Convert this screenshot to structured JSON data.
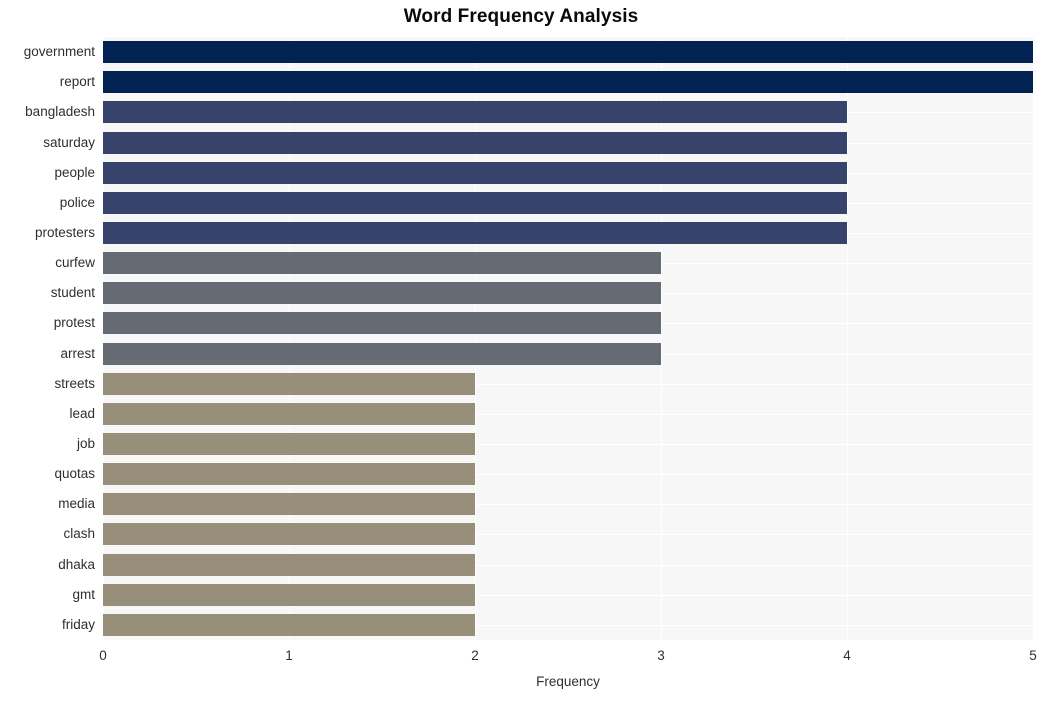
{
  "chart_data": {
    "type": "bar",
    "orientation": "horizontal",
    "title": "Word Frequency Analysis",
    "xlabel": "Frequency",
    "ylabel": "",
    "xlim": [
      0,
      5
    ],
    "xticks": [
      "0",
      "1",
      "2",
      "3",
      "4",
      "5"
    ],
    "grid": true,
    "legend": null,
    "categories": [
      "government",
      "report",
      "bangladesh",
      "saturday",
      "people",
      "police",
      "protesters",
      "curfew",
      "student",
      "protest",
      "arrest",
      "streets",
      "lead",
      "job",
      "quotas",
      "media",
      "clash",
      "dhaka",
      "gmt",
      "friday"
    ],
    "values": [
      5,
      5,
      4,
      4,
      4,
      4,
      4,
      3,
      3,
      3,
      3,
      2,
      2,
      2,
      2,
      2,
      2,
      2,
      2,
      2
    ],
    "bar_colors": [
      "#012253",
      "#012253",
      "#37436b",
      "#37436b",
      "#37436b",
      "#37436b",
      "#37436b",
      "#666a72",
      "#666a72",
      "#666a72",
      "#666a72",
      "#978f79",
      "#978f79",
      "#978f79",
      "#978f79",
      "#978f79",
      "#978f79",
      "#978f79",
      "#978f79",
      "#978f79"
    ],
    "palette": {
      "group_5": "#012253",
      "group_4": "#37436b",
      "group_3": "#666a72",
      "group_2": "#978f79"
    },
    "panel_background": "#f7f7f8",
    "figure_background": "#ffffff",
    "gridline_color": "#ffffff",
    "text_color": "#2f2f2f",
    "title_color": "#0a0a0a"
  }
}
